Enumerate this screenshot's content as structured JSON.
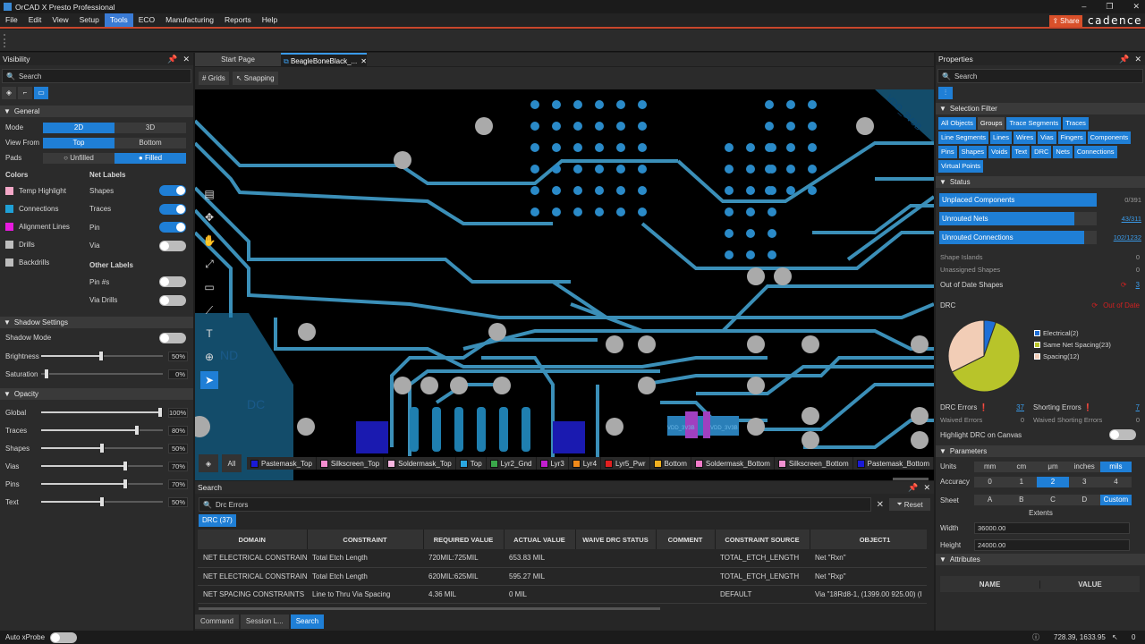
{
  "app": {
    "title": "OrCAD X Presto Professional",
    "share_label": "Share",
    "brand": "cadence"
  },
  "menu": [
    "File",
    "Edit",
    "View",
    "Setup",
    "Tools",
    "ECO",
    "Manufacturing",
    "Reports",
    "Help"
  ],
  "menu_active": "Tools",
  "visibility": {
    "title": "Visibility",
    "search_placeholder": "Search",
    "general_label": "General",
    "mode_label": "Mode",
    "mode_options": [
      "2D",
      "3D"
    ],
    "mode_selected": "2D",
    "viewfrom_label": "View From",
    "viewfrom_options": [
      "Top",
      "Bottom"
    ],
    "viewfrom_selected": "Top",
    "pads_label": "Pads",
    "pads_options": [
      "Unfilled",
      "Filled"
    ],
    "pads_selected": "Filled",
    "colors_label": "Colors",
    "colors": [
      {
        "label": "Temp Highlight",
        "color": "#f4a8c8"
      },
      {
        "label": "Connections",
        "color": "#1fa0d6"
      },
      {
        "label": "Alignment Lines",
        "color": "#e81adf"
      },
      {
        "label": "Drills",
        "color": "#bdbdbd"
      },
      {
        "label": "Backdrills",
        "color": "#bdbdbd"
      }
    ],
    "net_labels_label": "Net Labels",
    "net_labels": [
      {
        "label": "Shapes",
        "on": true
      },
      {
        "label": "Traces",
        "on": true
      },
      {
        "label": "Pin",
        "on": true
      },
      {
        "label": "Via",
        "on": false
      }
    ],
    "other_labels_label": "Other Labels",
    "other_labels": [
      {
        "label": "Pin #s",
        "on": false
      },
      {
        "label": "Via Drills",
        "on": false
      }
    ],
    "shadow_label": "Shadow Settings",
    "shadow_mode_label": "Shadow Mode",
    "brightness_label": "Brightness",
    "brightness": "50%",
    "saturation_label": "Saturation",
    "saturation": "0%",
    "opacity_label": "Opacity",
    "opacity": [
      {
        "label": "Global",
        "value": "100%"
      },
      {
        "label": "Traces",
        "value": "80%"
      },
      {
        "label": "Shapes",
        "value": "50%"
      },
      {
        "label": "Vias",
        "value": "70%"
      },
      {
        "label": "Pins",
        "value": "70%"
      },
      {
        "label": "Text",
        "value": "50%"
      }
    ]
  },
  "tabs": {
    "start": "Start Page",
    "doc": "BeagleBoneBlack_..."
  },
  "canvas": {
    "grids_label": "Grids",
    "snapping_label": "Snapping",
    "all_label": "All",
    "net_gnd": "ND",
    "net_dc": "DC",
    "net_vdd": "VDD_3V3B",
    "net_vdd2": "VDD_3V3B",
    "net_vdd3": "VDD_3V3B"
  },
  "layers": [
    {
      "label": "Pastemask_Top",
      "color": "#1a1ad6"
    },
    {
      "label": "Silkscreen_Top",
      "color": "#f48ed0"
    },
    {
      "label": "Soldermask_Top",
      "color": "#f6b6e0"
    },
    {
      "label": "Top",
      "color": "#2aa7e0"
    },
    {
      "label": "Lyr2_Gnd",
      "color": "#3aa84a"
    },
    {
      "label": "Lyr3",
      "color": "#c21fd0"
    },
    {
      "label": "Lyr4",
      "color": "#f08a1a"
    },
    {
      "label": "Lyr5_Pwr",
      "color": "#e02020"
    },
    {
      "label": "Bottom",
      "color": "#f0b020"
    },
    {
      "label": "Soldermask_Bottom",
      "color": "#f07ac8"
    },
    {
      "label": "Silkscreen_Bottom",
      "color": "#f090d0"
    },
    {
      "label": "Pastemask_Bottom",
      "color": "#1a1ad6"
    }
  ],
  "search_panel": {
    "title": "Search",
    "query": "Drc Errors",
    "reset_label": "Reset",
    "result_tab": "DRC (37)",
    "columns": [
      "DOMAIN",
      "CONSTRAINT",
      "REQUIRED VALUE",
      "ACTUAL VALUE",
      "WAIVE DRC STATUS",
      "COMMENT",
      "CONSTRAINT SOURCE",
      "OBJECT1"
    ],
    "rows": [
      [
        "NET ELECTRICAL CONSTRAINTS",
        "Total Etch Length",
        "720MIL:725MIL",
        "653.83 MIL",
        "",
        "",
        "TOTAL_ETCH_LENGTH",
        "Net \"Rxn\""
      ],
      [
        "NET ELECTRICAL CONSTRAINTS",
        "Total Etch Length",
        "620MIL:625MIL",
        "595.27 MIL",
        "",
        "",
        "TOTAL_ETCH_LENGTH",
        "Net \"Rxp\""
      ],
      [
        "NET SPACING CONSTRAINTS",
        "Line to Thru Via Spacing",
        "4.36 MIL",
        "0 MIL",
        "",
        "",
        "DEFAULT",
        "Via \"18Rd8-1, (1399.00 925.00) (I"
      ]
    ],
    "bottom_tabs": [
      "Command",
      "Session L...",
      "Search"
    ],
    "bottom_active": "Search"
  },
  "properties": {
    "title": "Properties",
    "search_placeholder": "Search",
    "selection_filter_label": "Selection Filter",
    "filter_chips": [
      {
        "label": "All Objects",
        "on": true
      },
      {
        "label": "Groups",
        "on": false
      },
      {
        "label": "Trace Segments",
        "on": true
      },
      {
        "label": "Traces",
        "on": true
      },
      {
        "label": "Line Segments",
        "on": true
      },
      {
        "label": "Lines",
        "on": true
      },
      {
        "label": "Wires",
        "on": true
      },
      {
        "label": "Vias",
        "on": true
      },
      {
        "label": "Fingers",
        "on": true
      },
      {
        "label": "Components",
        "on": true
      },
      {
        "label": "Pins",
        "on": true
      },
      {
        "label": "Shapes",
        "on": true
      },
      {
        "label": "Voids",
        "on": true
      },
      {
        "label": "Text",
        "on": true
      },
      {
        "label": "DRC",
        "on": true
      },
      {
        "label": "Nets",
        "on": true
      },
      {
        "label": "Connections",
        "on": true
      },
      {
        "label": "Virtual Points",
        "on": true
      }
    ],
    "status_label": "Status",
    "status_bars": [
      {
        "label": "Unplaced Components",
        "value": "0/391",
        "fill": 1.0
      },
      {
        "label": "Unrouted Nets",
        "value": "43/311",
        "fill": 0.86
      },
      {
        "label": "Unrouted Connections",
        "value": "102/1232",
        "fill": 0.92
      }
    ],
    "shape_islands_label": "Shape Islands",
    "shape_islands": "0",
    "unassigned_label": "Unassigned Shapes",
    "unassigned": "0",
    "ood_label": "Out of Date Shapes",
    "ood": "3",
    "drc_label": "DRC",
    "drc_status": "Out of Date",
    "pie": [
      {
        "label": "Electrical(2)",
        "value": 2,
        "color": "#1f6fd6"
      },
      {
        "label": "Same Net Spacing(23)",
        "value": 23,
        "color": "#b8c42a"
      },
      {
        "label": "Spacing(12)",
        "value": 12,
        "color": "#f2cdb6"
      }
    ],
    "drc_errors_label": "DRC Errors",
    "drc_errors": "37",
    "shorting_label": "Shorting Errors",
    "shorting": "7",
    "waived_label": "Waived Errors",
    "waived": "0",
    "waived_short_label": "Waived Shorting Errors",
    "waived_short": "0",
    "highlight_label": "Highlight DRC on Canvas",
    "parameters_label": "Parameters",
    "units_label": "Units",
    "units": [
      "mm",
      "cm",
      "μm",
      "inches",
      "mils"
    ],
    "units_selected": "mils",
    "accuracy_label": "Accuracy",
    "accuracy": [
      "0",
      "1",
      "2",
      "3",
      "4"
    ],
    "accuracy_selected": "2",
    "sheet_label": "Sheet",
    "sheet": [
      "A",
      "B",
      "C",
      "D",
      "Custom"
    ],
    "sheet_selected": "Custom",
    "extents_label": "Extents",
    "width_label": "Width",
    "width": "36000.00",
    "height_label": "Height",
    "height": "24000.00",
    "attributes_label": "Attributes",
    "attr_name": "NAME",
    "attr_value": "VALUE"
  },
  "statusbar": {
    "xprobe": "Auto xProbe",
    "coords": "728.39, 1633.95",
    "count": "0"
  }
}
